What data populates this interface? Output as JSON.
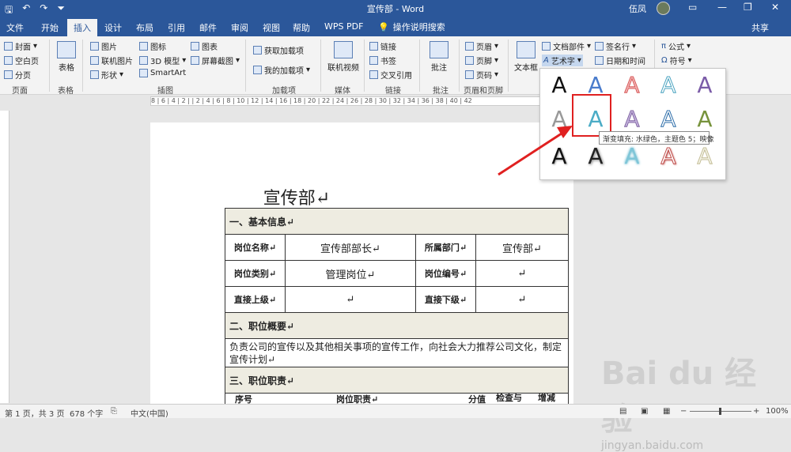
{
  "window": {
    "title": "宣传部 - Word",
    "user": "伍凤",
    "share": "共享"
  },
  "tabs": [
    "文件",
    "开始",
    "插入",
    "设计",
    "布局",
    "引用",
    "邮件",
    "审阅",
    "视图",
    "帮助",
    "WPS PDF"
  ],
  "tell_me": "操作说明搜索",
  "ribbon": {
    "pages": {
      "cover": "封面",
      "blank": "空白页",
      "break": "分页",
      "label": "页面"
    },
    "tables": {
      "table": "表格",
      "label": "表格"
    },
    "illustrations": {
      "picture": "图片",
      "online_picture": "联机图片",
      "shapes": "形状",
      "icons": "图标",
      "model3d": "3D 模型",
      "smartart": "SmartArt",
      "chart": "图表",
      "screenshot": "屏幕截图",
      "label": "插图"
    },
    "addins": {
      "get": "获取加载项",
      "my": "我的加载项",
      "label": "加载项"
    },
    "media": {
      "video": "联机视频",
      "label": "媒体"
    },
    "links": {
      "link": "链接",
      "bookmark": "书签",
      "cross_ref": "交叉引用",
      "label": "链接"
    },
    "comments": {
      "comment": "批注",
      "label": "批注"
    },
    "header_footer": {
      "header": "页眉",
      "footer": "页脚",
      "page_number": "页码",
      "label": "页眉和页脚"
    },
    "text": {
      "textbox": "文本框",
      "quick_parts": "文档部件",
      "wordart": "艺术字",
      "signature": "签名行",
      "datetime": "日期和时间"
    },
    "symbols": {
      "equation": "公式",
      "symbol": "符号"
    }
  },
  "ruler_text": "8 | 6 | 4 | 2 | | 2 | 4 | 6 | 8 | 10 | 12 | 14 | 16 | 18 | 20 | 22 | 24 | 26 | 28 | 30 | 32 | 34 | 36 | 38 | 40 | 42",
  "document": {
    "title": "宣传部↵",
    "sec1": "一、基本信息↵",
    "row1": {
      "l1": "岗位名称↵",
      "v1": "宣传部部长↵",
      "l2": "所属部门↵",
      "v2": "宣传部↵"
    },
    "row2": {
      "l1": "岗位类别↵",
      "v1": "管理岗位↵",
      "l2": "岗位编号↵",
      "v2": "↵"
    },
    "row3": {
      "l1": "直接上级↵",
      "v1": "↵",
      "l2": "直接下级↵",
      "v2": "↵"
    },
    "sec2": "二、职位概要↵",
    "summary": "负责公司的宣传以及其他相关事项的宣传工作，向社会大力推荐公司文化，制定宣传计划↵",
    "sec3": "三、职位职责↵",
    "h1": "序号",
    "h2": "岗位职责↵",
    "h3": "分值",
    "h4": "检查与",
    "h5": "增减"
  },
  "wordart": {
    "letter": "A",
    "tooltip": "渐变填充: 水绿色，主题色 5；映像"
  },
  "status": {
    "page": "第 1 页，共 3 页",
    "words": "678 个字",
    "lang": "中文(中国)",
    "zoom": "100%"
  },
  "watermark": {
    "main": "Bai du 经验",
    "sub": "jingyan.baidu.com"
  }
}
